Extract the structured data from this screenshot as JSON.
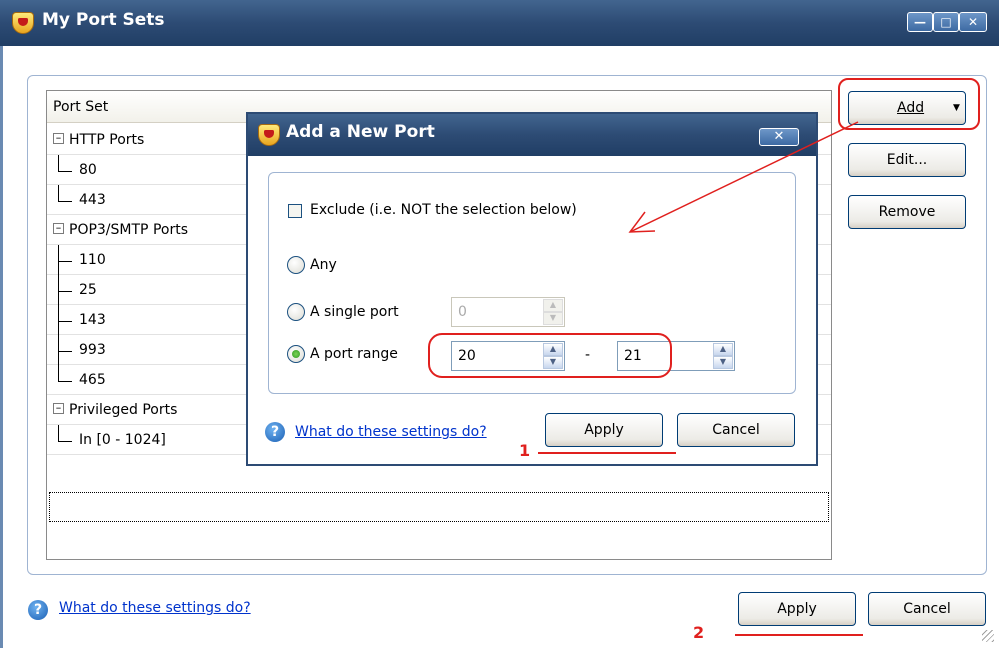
{
  "window": {
    "title": "My Port Sets",
    "controls": [
      "minimize",
      "maximize",
      "close"
    ]
  },
  "list": {
    "header": "Port Set",
    "groups": [
      {
        "label": "HTTP Ports",
        "items": [
          "80",
          "443"
        ]
      },
      {
        "label": "POP3/SMTP Ports",
        "items": [
          "110",
          "25",
          "143",
          "993",
          "465"
        ]
      },
      {
        "label": "Privileged Ports",
        "items": [
          "In [0 - 1024]"
        ]
      }
    ]
  },
  "side_buttons": {
    "add": "Add",
    "edit": "Edit...",
    "remove": "Remove"
  },
  "footer": {
    "help_link": "What do these settings do?",
    "apply": "Apply",
    "cancel": "Cancel"
  },
  "dialog": {
    "title": "Add a New Port",
    "exclude_label": "Exclude (i.e. NOT the selection below)",
    "exclude_checked": false,
    "options": {
      "any": "Any",
      "single": "A single port",
      "range": "A port range"
    },
    "selected": "range",
    "single_value": "0",
    "range_from": "20",
    "range_to": "21",
    "range_sep": "-",
    "help_link": "What do these settings do?",
    "apply": "Apply",
    "cancel": "Cancel"
  },
  "annotations": {
    "step1": "1",
    "step2": "2",
    "color": "#e0201e"
  },
  "colors": {
    "titlebar": "#2d4b74",
    "link": "#0033cc"
  },
  "icons": {
    "app": "shield-icon",
    "help": "help-icon"
  }
}
